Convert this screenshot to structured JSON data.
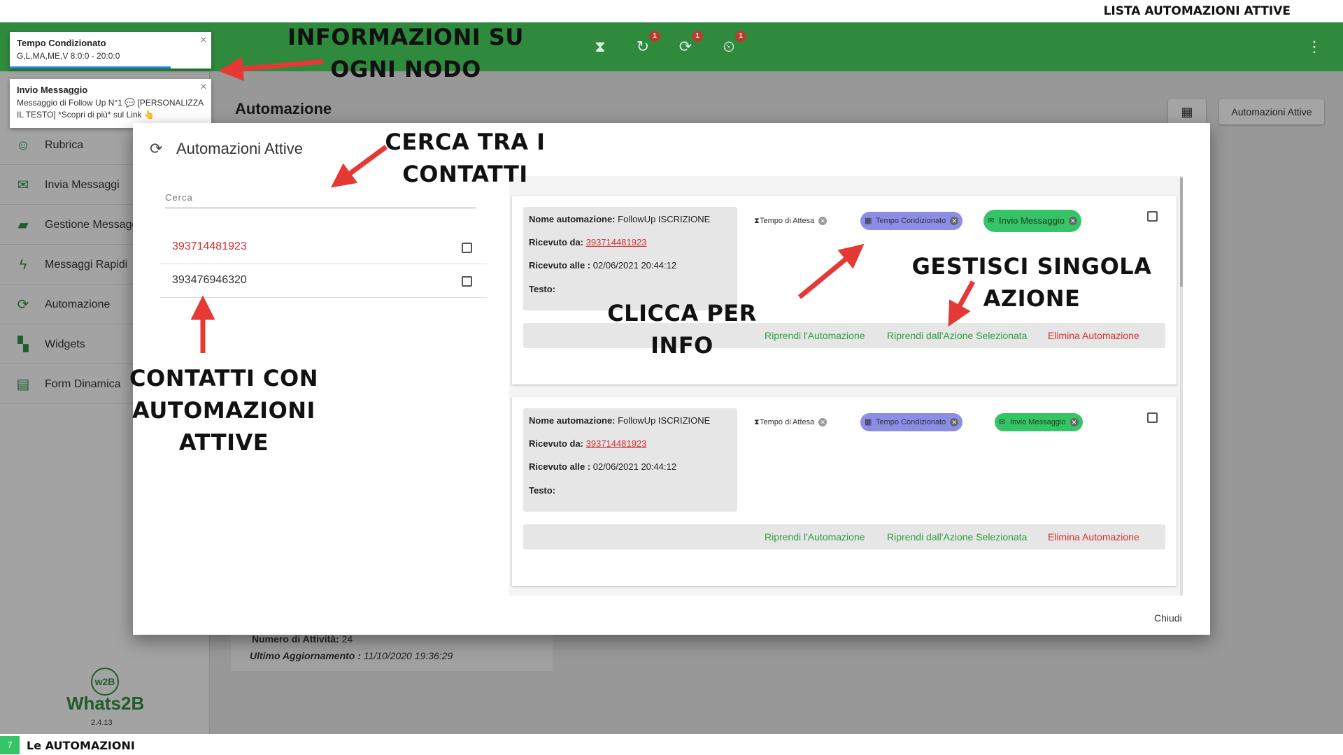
{
  "top_caption": "LISTA AUTOMAZIONI ATTIVE",
  "header": {
    "icons": [
      {
        "name": "hourglass-icon",
        "badge": ""
      },
      {
        "name": "history-icon",
        "badge": "1"
      },
      {
        "name": "sync-icon",
        "badge": "1"
      },
      {
        "name": "timer-off-icon",
        "badge": "1"
      }
    ]
  },
  "toasts": [
    {
      "title": "Tempo Condizionato",
      "body": "G,L,MA,ME,V 8:0:0 - 20:0:0"
    },
    {
      "title": "Invio Messaggio",
      "body": "Messaggio di Follow Up N°1 💬 [PERSONALIZZA IL TESTO] *Scopri di più* sul Link 👆"
    }
  ],
  "sidebar": {
    "items": [
      {
        "label": "Rubrica",
        "icon": "contacts-icon"
      },
      {
        "label": "Invia Messaggi",
        "icon": "mail-icon"
      },
      {
        "label": "Gestione Messaggi",
        "icon": "folder-icon"
      },
      {
        "label": "Messaggi Rapidi",
        "icon": "bolt-icon"
      },
      {
        "label": "Automazione",
        "icon": "sync-icon"
      },
      {
        "label": "Widgets",
        "icon": "widgets-icon"
      },
      {
        "label": "Form Dinamica",
        "icon": "form-icon"
      }
    ]
  },
  "page": {
    "title": "Automazione",
    "active_button": "Automazioni Attive"
  },
  "background_card": {
    "activities_label": "Numero di Attività:",
    "activities_value": "24",
    "updated_label": "Ultimo Aggiornamento :",
    "updated_value": "11/10/2020 19:36:29"
  },
  "logo": {
    "mark": "w2B",
    "name": "Whats2B",
    "version": "2.4.13"
  },
  "modal": {
    "title": "Automazioni Attive",
    "search_placeholder": "Cerca",
    "contacts": [
      {
        "number": "393714481923",
        "selected": true
      },
      {
        "number": "393476946320",
        "selected": false
      }
    ],
    "automations": [
      {
        "name_label": "Nome automazione:",
        "name": "FollowUp ISCRIZIONE",
        "from_label": "Ricevuto da:",
        "from": "393714481923",
        "at_label": "Ricevuto alle :",
        "at": "02/06/2021 20:44:12",
        "text_label": "Testo:",
        "text": "",
        "steps": [
          {
            "label": "Tempo di Attesa",
            "style": "plain",
            "icon": "hourglass-icon"
          },
          {
            "label": "Tempo Condizionato",
            "style": "purple",
            "icon": "calendar-icon"
          },
          {
            "label": "Invio Messaggio",
            "style": "green",
            "icon": "mail-icon"
          }
        ],
        "actions": {
          "resume": "Riprendi l'Automazione",
          "resume_selected": "Riprendi dall'Azione Selezionata",
          "delete": "Elimina Automazione"
        }
      },
      {
        "name_label": "Nome automazione:",
        "name": "FollowUp ISCRIZIONE",
        "from_label": "Ricevuto da:",
        "from": "393714481923",
        "at_label": "Ricevuto alle :",
        "at": "02/06/2021 20:44:12",
        "text_label": "Testo:",
        "text": "",
        "steps": [
          {
            "label": "Tempo di Attesa",
            "style": "plain",
            "icon": "hourglass-icon"
          },
          {
            "label": "Tempo Condizionato",
            "style": "purple",
            "icon": "calendar-icon"
          },
          {
            "label": "Invio Messaggio",
            "style": "green",
            "icon": "mail-icon"
          }
        ],
        "actions": {
          "resume": "Riprendi l'Automazione",
          "resume_selected": "Riprendi dall'Azione Selezionata",
          "delete": "Elimina Automazione"
        }
      }
    ],
    "close_label": "Chiudi"
  },
  "annotations": {
    "info_nodes_1": "INFORMAZIONI SU",
    "info_nodes_2": "OGNI NODO",
    "search_1": "CERCA TRA I",
    "search_2": "CONTATTI",
    "manage_1": "GESTISCI SINGOLA",
    "manage_2": "AZIONE",
    "click_info": "CLICCA PER INFO",
    "contacts_1": "CONTATTI CON",
    "contacts_2": "AUTOMAZIONI",
    "contacts_3": "ATTIVE"
  },
  "footer": {
    "page_number": "7",
    "label": "Le AUTOMAZIONI"
  },
  "colors": {
    "brand_green": "#2f8a3e",
    "danger_red": "#d32f2f",
    "chip_purple": "#8c8de6",
    "chip_green": "#35c566"
  }
}
